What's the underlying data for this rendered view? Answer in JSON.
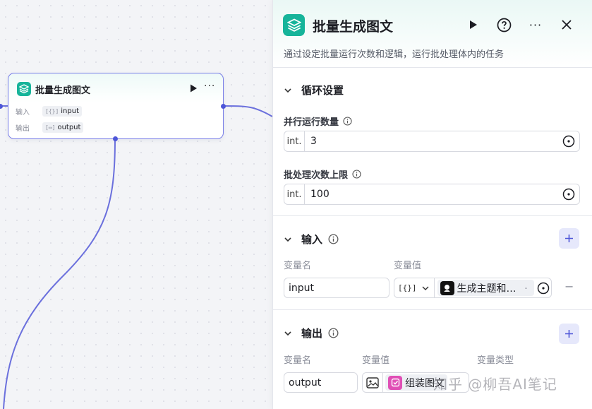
{
  "node": {
    "title": "批量生成图文",
    "input_label": "输入",
    "input_var": "input",
    "input_type_icon": "[{}]",
    "output_label": "输出",
    "output_var": "output",
    "output_type_icon": "[▭]"
  },
  "panel": {
    "title": "批量生成图文",
    "description": "通过设定批量运行次数和逻辑，运行批处理体内的任务",
    "loop_section": {
      "title": "循环设置",
      "parallel_label": "并行运行数量",
      "parallel_type": "int.",
      "parallel_value": "3",
      "limit_label": "批处理次数上限",
      "limit_type": "int.",
      "limit_value": "100"
    },
    "input_section": {
      "title": "输入",
      "col_name": "变量名",
      "col_value": "变量值",
      "var_name": "input",
      "var_type": "[{}]",
      "ref_text": "生成主题和…",
      "ref_suffix": "-",
      "remove_symbol": "−"
    },
    "output_section": {
      "title": "输出",
      "col_name": "变量名",
      "col_value": "变量值",
      "col_type": "变量类型",
      "var_name": "output",
      "ref_text": "组装图文"
    }
  },
  "watermark": "知乎 @柳吾AI笔记",
  "colors": {
    "accent": "#4e56d8",
    "node_icon": "#16b49a",
    "edge": "#6b70dd"
  }
}
